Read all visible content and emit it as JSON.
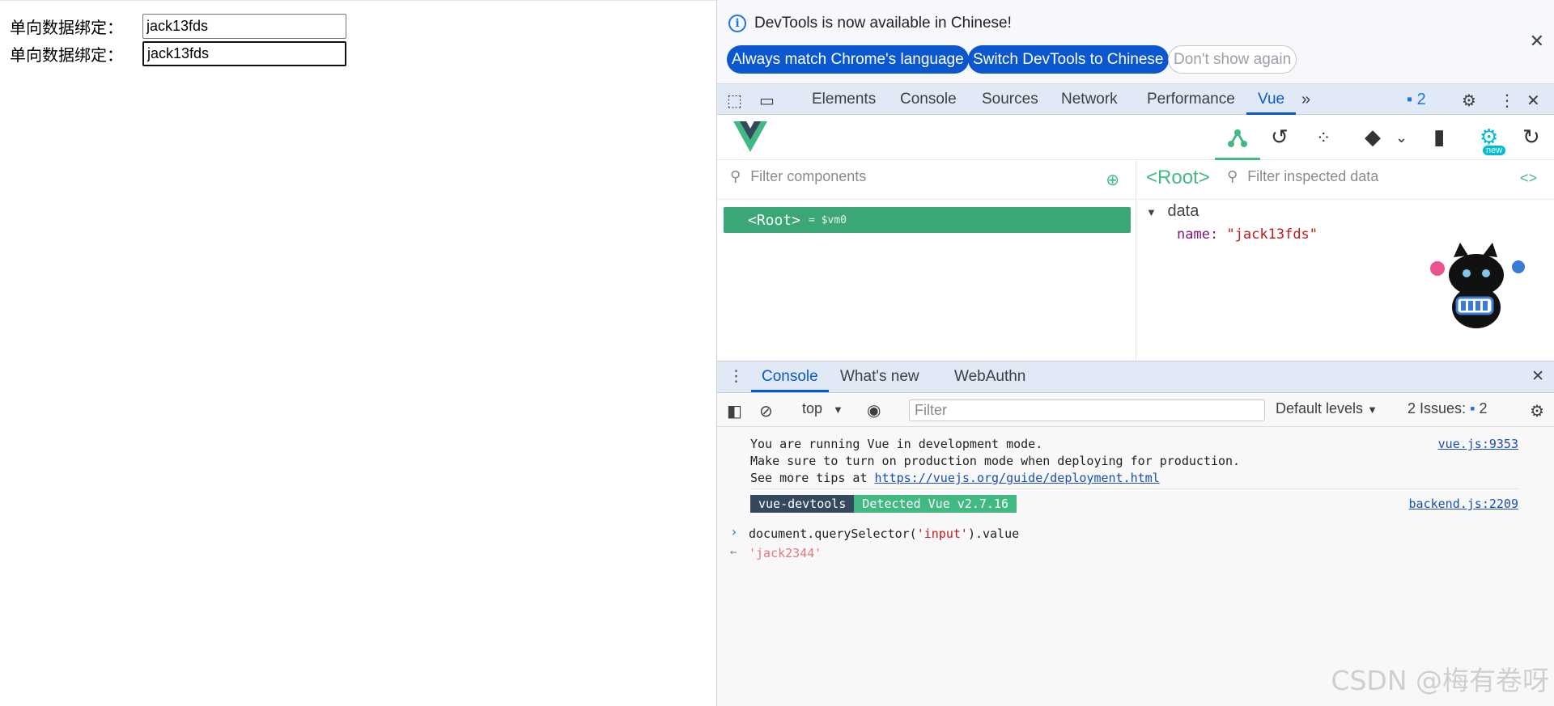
{
  "page": {
    "rows": [
      {
        "label": "单向数据绑定：",
        "value": "jack13fds"
      },
      {
        "label": "单向数据绑定：",
        "value": "jack13fds"
      }
    ]
  },
  "infobar": {
    "message": "DevTools is now available in Chinese!",
    "btn_match": "Always match Chrome's language",
    "btn_switch": "Switch DevTools to Chinese",
    "btn_dont": "Don't show again"
  },
  "tabs": [
    "Elements",
    "Console",
    "Sources",
    "Network",
    "Performance",
    "Vue"
  ],
  "issues_count": "2",
  "vue": {
    "filter_components": "Filter components",
    "root_label": "<Root>",
    "root_vm": "= $vm0",
    "inspect_title": "<Root>",
    "filter_inspected": "Filter inspected data",
    "data_section": "data",
    "data_key": "name",
    "data_value": "\"jack13fds\"",
    "new_badge": "new"
  },
  "drawer_tabs": [
    "Console",
    "What's new",
    "WebAuthn"
  ],
  "console_toolbar": {
    "context": "top",
    "filter_placeholder": "Filter",
    "levels": "Default levels",
    "issues_label": "2 Issues:",
    "issues_count": "2"
  },
  "console": {
    "line1": "You are running Vue in development mode.",
    "line2": "Make sure to turn on production mode when deploying for production.",
    "line3_prefix": "See more tips at ",
    "line3_link": "https://vuejs.org/guide/deployment.html",
    "src1": "vue.js:9353",
    "badge_dark": "vue-devtools",
    "badge_green": "Detected Vue v2.7.16",
    "src2": "backend.js:2209",
    "input_prefix": "document.querySelector(",
    "input_arg": "'input'",
    "input_suffix": ").value",
    "output": "'jack2344'"
  },
  "watermark": "CSDN @梅有卷呀",
  "colors": {
    "vue_green": "#42b883",
    "devtools_blue": "#0b57d0",
    "tab_bar": "#e1e9f7"
  }
}
